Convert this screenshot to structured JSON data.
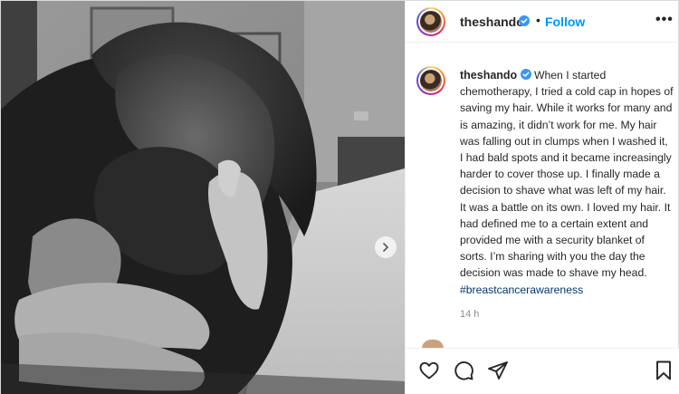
{
  "post": {
    "username": "theshando",
    "separator": "•",
    "follow_label": "Follow",
    "more_label": "•••",
    "caption_username": "theshando",
    "caption_text": "When I started chemotherapy, I tried a cold cap in hopes of saving my hair. While it works for many and is amazing, it didn’t work for me. My hair was falling out in clumps when I washed it, I had bald spots and it became increasingly harder to cover those up. I finally made a decision to shave what was left of my hair. It was a battle on its own. I loved my hair. It had defined me to a certain extent and provided me with a security blanket of sorts. I’m sharing with you the day the decision was made to shave my head.",
    "hashtag": "#breastcancerawareness",
    "timestamp": "14 h"
  },
  "icons": {
    "verified": "verified-badge-icon",
    "like": "heart-icon",
    "comment": "comment-bubble-icon",
    "share": "paper-plane-icon",
    "save": "bookmark-icon",
    "next": "chevron-right-icon"
  },
  "colors": {
    "accent": "#0095f6",
    "hashtag": "#00376b",
    "text": "#262626",
    "muted": "#8e8e8e",
    "border": "#efefef"
  }
}
